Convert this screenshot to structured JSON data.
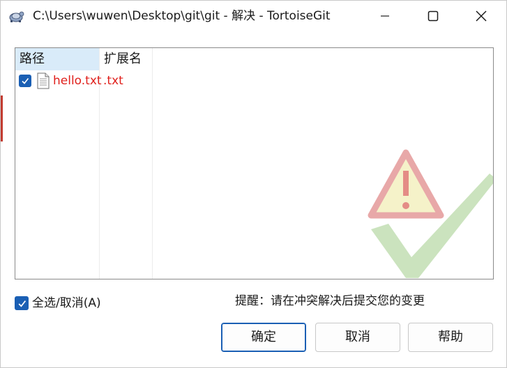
{
  "window": {
    "title": "C:\\Users\\wuwen\\Desktop\\git\\git - 解决 - TortoiseGit",
    "controls": {
      "minimize": "minimize-icon",
      "maximize": "maximize-icon",
      "close": "close-icon"
    }
  },
  "filelist": {
    "columns": [
      "路径",
      "扩展名"
    ],
    "rows": [
      {
        "checked": true,
        "name": "hello.txt",
        "ext": ".txt",
        "icon": "text-file-icon"
      }
    ],
    "colors": {
      "conflict_text": "#e0201c",
      "header_selected": "#d9ebf9"
    }
  },
  "select_all": {
    "label": "全选/取消(A)",
    "checked": true
  },
  "hint": "提醒：请在冲突解决后提交您的变更",
  "buttons": {
    "ok": "确定",
    "cancel": "取消",
    "help": "帮助"
  },
  "accent": "#1a5fb4"
}
